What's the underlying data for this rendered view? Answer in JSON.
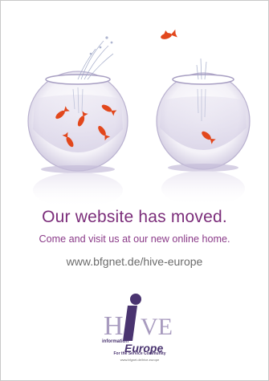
{
  "poster": {
    "headline": "Our website has moved.",
    "subline": "Come and visit us at our new online home.",
    "url": "www.bfgnet.de/hive-europe"
  },
  "logo": {
    "wordmark": "HiVE information Europe",
    "tagline": "For the Service Community",
    "url": "www.bfgnet.de/hive-europe",
    "colors": {
      "purple": "#4a3470",
      "violet": "#7a4f9c"
    }
  },
  "colors": {
    "headline": "#7b2d7a",
    "fish": "#e2471c",
    "glass": "#d9d4e6"
  },
  "scene": {
    "icons": [
      "fishbowl-left",
      "fishbowl-right",
      "goldfish"
    ]
  }
}
